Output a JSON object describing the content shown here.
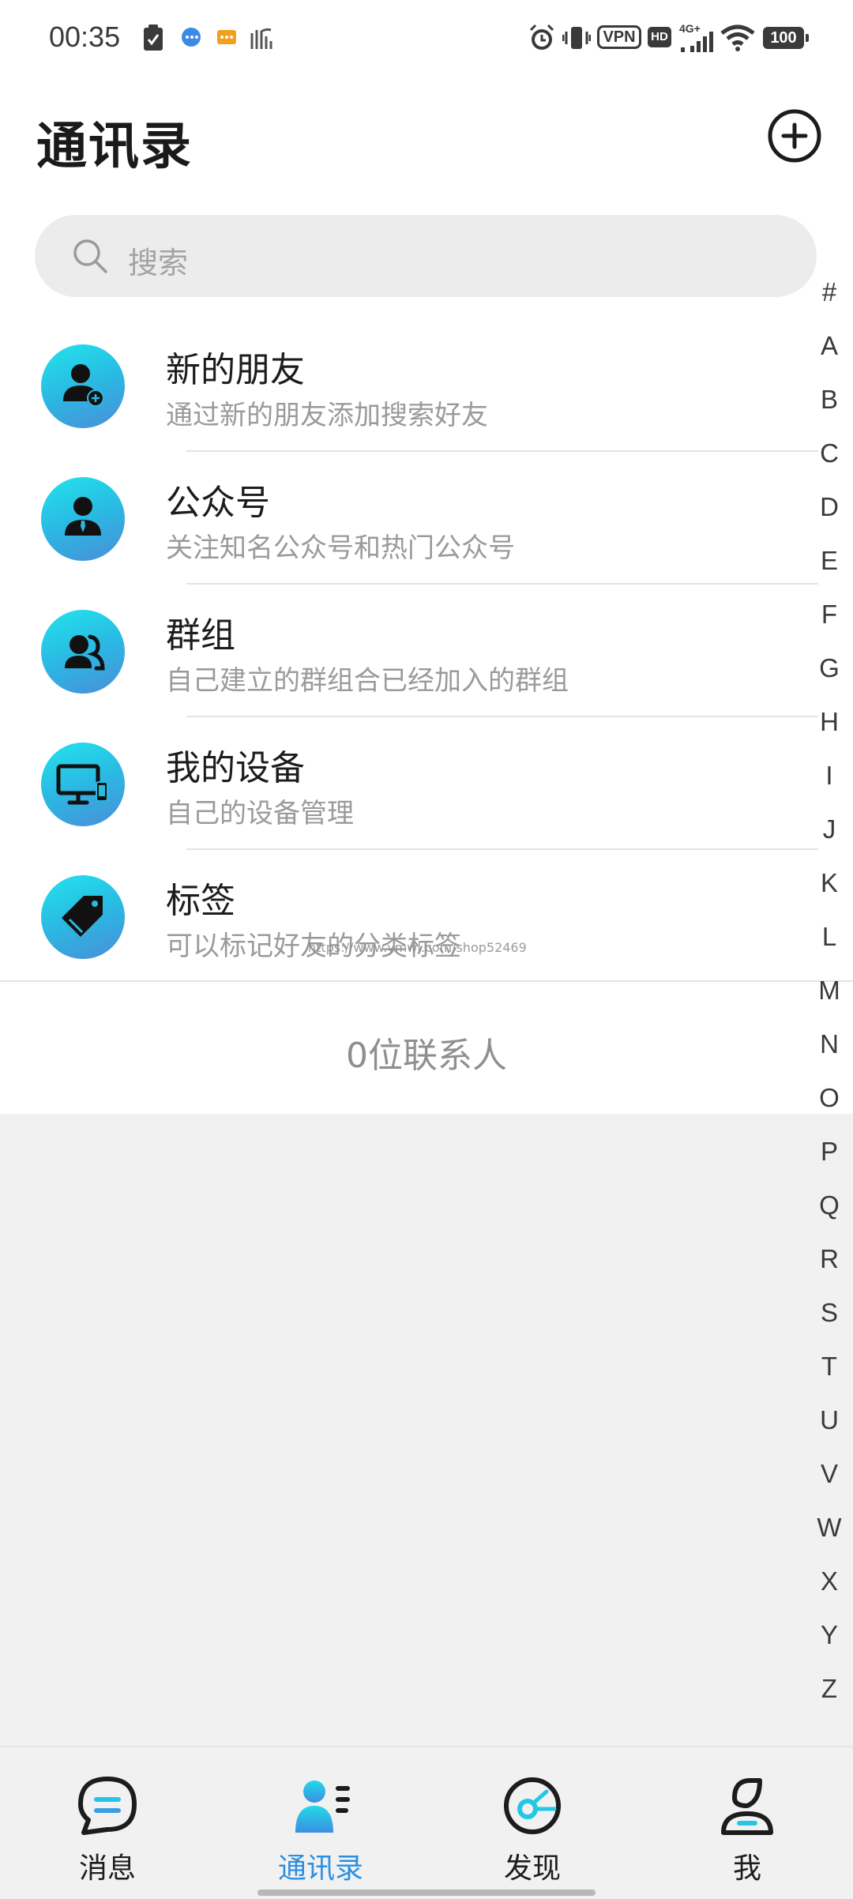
{
  "status_bar": {
    "time": "00:35",
    "vpn": "VPN",
    "hd": "HD",
    "network": "4G+",
    "battery": "100"
  },
  "header": {
    "title": "通讯录"
  },
  "search": {
    "placeholder": "搜索"
  },
  "menu": [
    {
      "title": "新的朋友",
      "subtitle": "通过新的朋友添加搜索好友"
    },
    {
      "title": "公众号",
      "subtitle": "关注知名公众号和热门公众号"
    },
    {
      "title": "群组",
      "subtitle": "自己建立的群组合已经加入的群组"
    },
    {
      "title": "我的设备",
      "subtitle": "自己的设备管理"
    },
    {
      "title": "标签",
      "subtitle": "可以标记好友的分类标签"
    }
  ],
  "watermark": "https://www.ymwl.com/shop52469",
  "contact_count": "0位联系人",
  "alphabet": [
    "#",
    "A",
    "B",
    "C",
    "D",
    "E",
    "F",
    "G",
    "H",
    "I",
    "J",
    "K",
    "L",
    "M",
    "N",
    "O",
    "P",
    "Q",
    "R",
    "S",
    "T",
    "U",
    "V",
    "W",
    "X",
    "Y",
    "Z"
  ],
  "nav": [
    {
      "label": "消息"
    },
    {
      "label": "通讯录"
    },
    {
      "label": "发现"
    },
    {
      "label": "我"
    }
  ],
  "colors": {
    "accent": "#2a8fe0",
    "avatar_gradient_start": "#22e4ec",
    "avatar_gradient_end": "#4a8ed8"
  }
}
